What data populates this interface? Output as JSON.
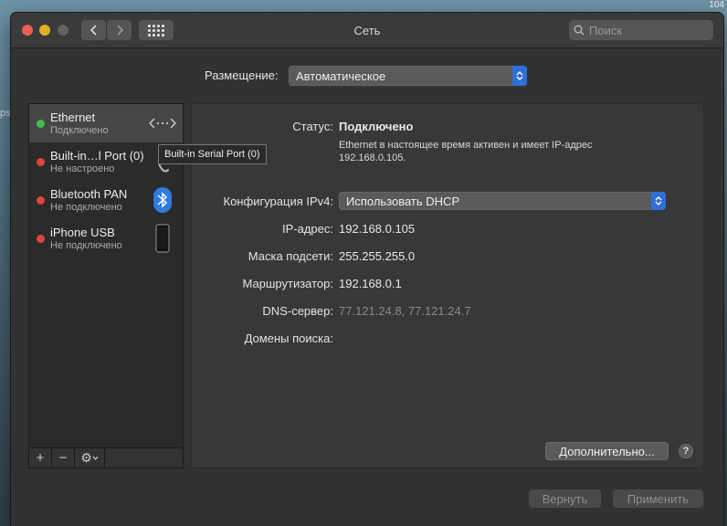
{
  "window": {
    "title": "Сеть"
  },
  "search": {
    "placeholder": "Поиск"
  },
  "location": {
    "label": "Размещение:",
    "value": "Автоматическое"
  },
  "services": [
    {
      "name": "Ethernet",
      "status": "Подключено",
      "status_color": "#3fbf4a",
      "icon": "ethernet-arrows-icon"
    },
    {
      "name": "Built-in…l Port (0)",
      "status": "Не настроено",
      "status_color": "#e0443d",
      "icon": "phone-handset-icon"
    },
    {
      "name": "Bluetooth PAN",
      "status": "Не подключено",
      "status_color": "#e0443d",
      "icon": "bluetooth-icon"
    },
    {
      "name": "iPhone USB",
      "status": "Не подключено",
      "status_color": "#e0443d",
      "icon": "iphone-icon"
    }
  ],
  "tooltip": {
    "text": "Built-in Serial Port (0)"
  },
  "sidebar_controls": {
    "add": "+",
    "remove": "−",
    "gear": "⚙"
  },
  "details": {
    "status_label": "Статус:",
    "status_value": "Подключено",
    "status_desc": "Ethernet в настоящее время активен и имеет IP-адрес 192.168.0.105.",
    "ipv4_label": "Конфигурация IPv4:",
    "ipv4_value": "Использовать DHCP",
    "ip_label": "IP-адрес:",
    "ip_value": "192.168.0.105",
    "mask_label": "Маска подсети:",
    "mask_value": "255.255.255.0",
    "router_label": "Маршрутизатор:",
    "router_value": "192.168.0.1",
    "dns_label": "DNS-сервер:",
    "dns_value": "77.121.24.8, 77.121.24.7",
    "domains_label": "Домены поиска:"
  },
  "buttons": {
    "advanced": "Дополнительно...",
    "help": "?",
    "revert": "Вернуть",
    "apply": "Применить"
  },
  "colors": {
    "accent": "#2f6fd8",
    "connected": "#3fbf4a",
    "disconnected": "#e0443d"
  }
}
